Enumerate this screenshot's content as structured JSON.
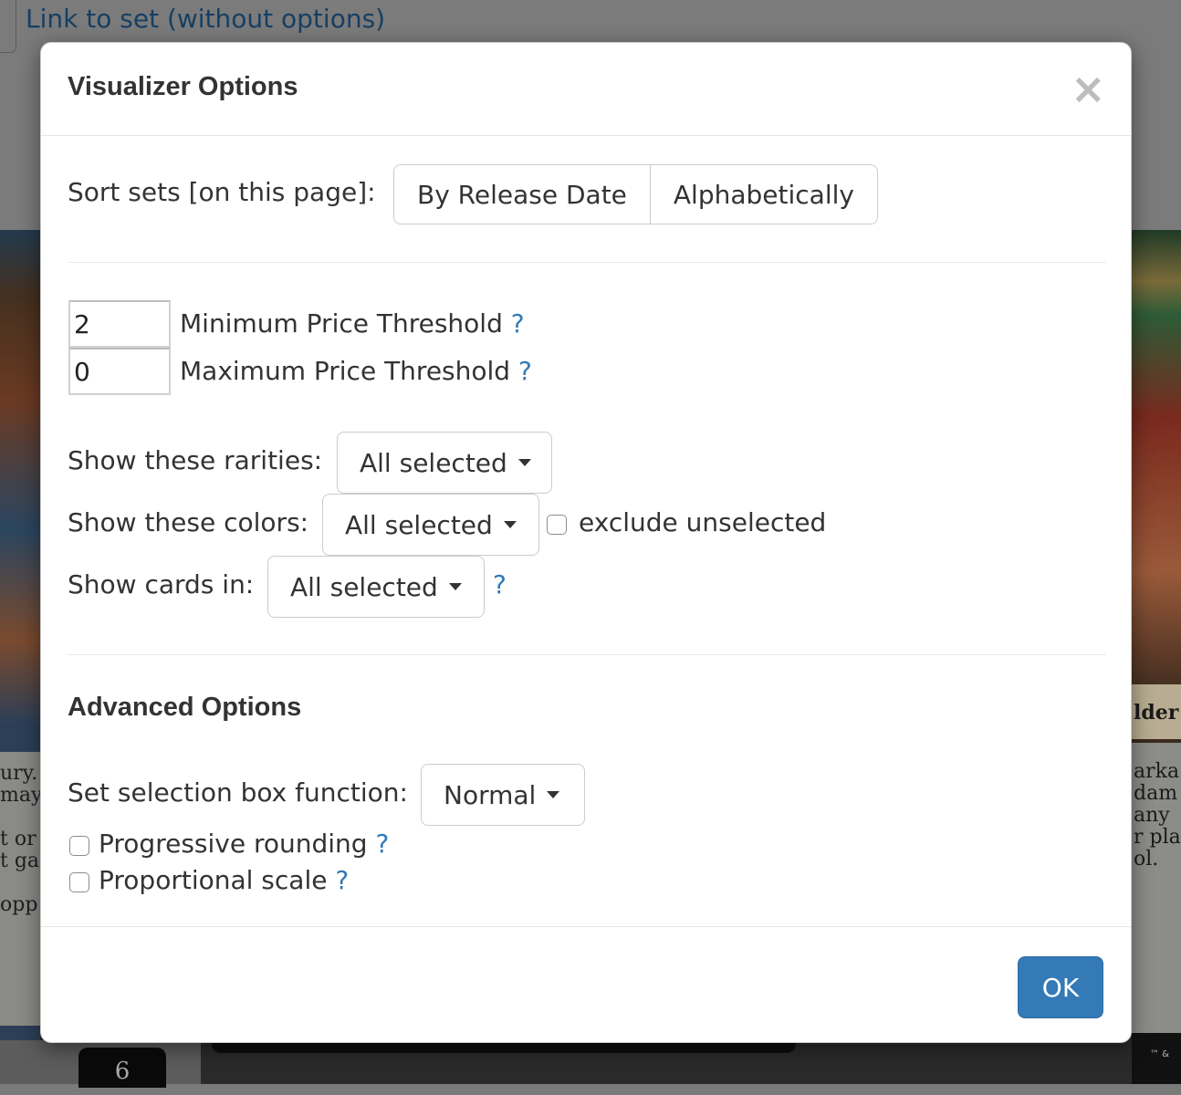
{
  "background": {
    "link_text": "Link to set (without options)",
    "left_card_text": "ury.\nmay\n\nt or\nt ga\n\nopp",
    "left_card_cost": "6",
    "right_card_name": "lder",
    "right_card_text": "arka\ndam\nany\nr pla\nol.",
    "right_card_footer": "™ &"
  },
  "modal": {
    "title": "Visualizer Options",
    "close_label": "×",
    "sort": {
      "label": "Sort sets [on this page]:",
      "options": [
        "By Release Date",
        "Alphabetically"
      ]
    },
    "price": {
      "min_value": "2",
      "min_label": "Minimum Price Threshold",
      "max_value": "0",
      "max_label": "Maximum Price Threshold",
      "help": "?"
    },
    "rarities": {
      "label": "Show these rarities:",
      "value": "All selected"
    },
    "colors": {
      "label": "Show these colors:",
      "value": "All selected",
      "exclude_label": "exclude unselected",
      "exclude_checked": false
    },
    "cards_in": {
      "label": "Show cards in:",
      "value": "All selected",
      "help": "?"
    },
    "advanced": {
      "title": "Advanced Options",
      "selection_label": "Set selection box function:",
      "selection_value": "Normal",
      "progressive_label": "Progressive rounding",
      "progressive_checked": false,
      "proportional_label": "Proportional scale",
      "proportional_checked": false,
      "help": "?"
    },
    "ok_label": "OK"
  }
}
